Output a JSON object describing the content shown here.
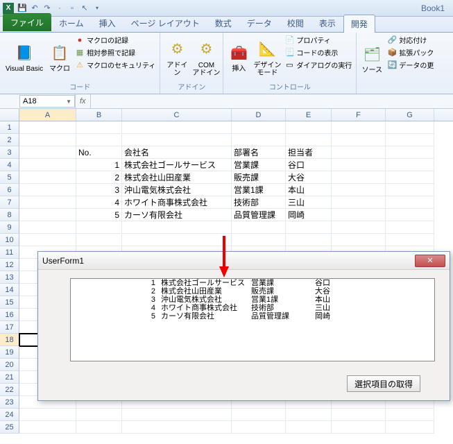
{
  "title": "Book1",
  "tabs": {
    "file": "ファイル",
    "items": [
      "ホーム",
      "挿入",
      "ページ レイアウト",
      "数式",
      "データ",
      "校閲",
      "表示",
      "開発"
    ],
    "active": 7
  },
  "ribbon": {
    "code": {
      "vb": "Visual Basic",
      "macro": "マクロ",
      "record": "マクロの記録",
      "relref": "相対参照で記録",
      "security": "マクロのセキュリティ",
      "label": "コード"
    },
    "addins": {
      "addin": "アドイン",
      "com": "COM\nアドイン",
      "label": "アドイン"
    },
    "controls": {
      "insert": "挿入",
      "design": "デザイン\nモード",
      "prop": "プロパティ",
      "viewcode": "コードの表示",
      "dialog": "ダイアログの実行",
      "label": "コントロール"
    },
    "xml": {
      "source": "ソース",
      "map": "対応付け",
      "expand": "拡張パック",
      "refresh": "データの更"
    }
  },
  "namebox": "A18",
  "formula": "",
  "cols": [
    "A",
    "B",
    "C",
    "D",
    "E",
    "F",
    "G"
  ],
  "sheet": {
    "headers": {
      "no": "No.",
      "company": "会社名",
      "dept": "部署名",
      "person": "担当者"
    },
    "rows": [
      {
        "n": "1",
        "c": "株式会社ゴールサービス",
        "d": "営業課",
        "p": "谷口"
      },
      {
        "n": "2",
        "c": "株式会社山田産業",
        "d": "販売課",
        "p": "大谷"
      },
      {
        "n": "3",
        "c": "沖山電気株式会社",
        "d": "営業1課",
        "p": "本山"
      },
      {
        "n": "4",
        "c": "ホワイト商事株式会社",
        "d": "技術部",
        "p": "三山"
      },
      {
        "n": "5",
        "c": "カーソ有限会社",
        "d": "品質管理課",
        "p": "岡崎"
      }
    ]
  },
  "userform": {
    "title": "UserForm1",
    "button": "選択項目の取得",
    "list": [
      {
        "n": "1",
        "c": "株式会社ゴールサービス",
        "d": "営業課",
        "p": "谷口"
      },
      {
        "n": "2",
        "c": "株式会社山田産業",
        "d": "販売課",
        "p": "大谷"
      },
      {
        "n": "3",
        "c": "沖山電気株式会社",
        "d": "営業1課",
        "p": "本山"
      },
      {
        "n": "4",
        "c": "ホワイト商事株式会社",
        "d": "技術部",
        "p": "三山"
      },
      {
        "n": "5",
        "c": "カーソ有限会社",
        "d": "品質管理課",
        "p": "岡崎"
      }
    ]
  },
  "chart_data": {
    "type": "table",
    "title": "",
    "columns": [
      "No.",
      "会社名",
      "部署名",
      "担当者"
    ],
    "rows": [
      [
        1,
        "株式会社ゴールサービス",
        "営業課",
        "谷口"
      ],
      [
        2,
        "株式会社山田産業",
        "販売課",
        "大谷"
      ],
      [
        3,
        "沖山電気株式会社",
        "営業1課",
        "本山"
      ],
      [
        4,
        "ホワイト商事株式会社",
        "技術部",
        "三山"
      ],
      [
        5,
        "カーソ有限会社",
        "品質管理課",
        "岡崎"
      ]
    ]
  }
}
